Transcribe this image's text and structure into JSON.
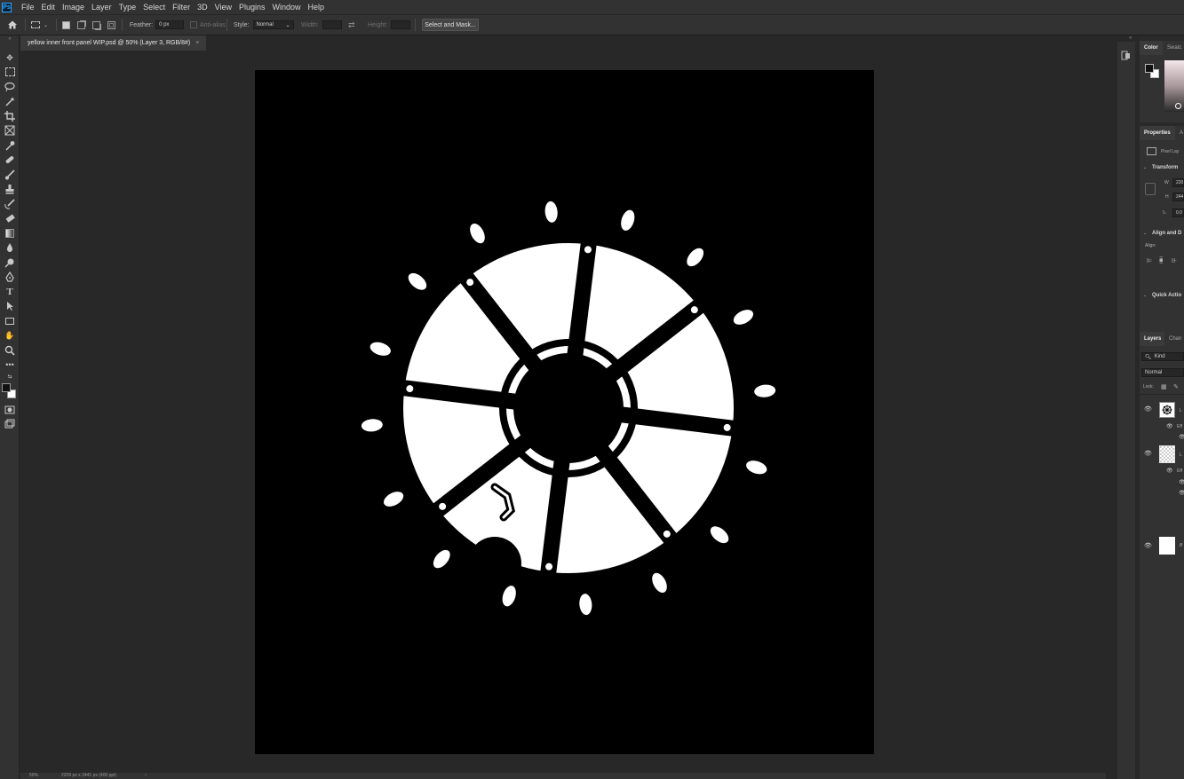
{
  "app": {
    "logo": "Ps"
  },
  "menu": [
    "File",
    "Edit",
    "Image",
    "Layer",
    "Type",
    "Select",
    "Filter",
    "3D",
    "View",
    "Plugins",
    "Window",
    "Help"
  ],
  "options": {
    "home_icon": "home-icon",
    "feather_label": "Feather:",
    "feather_value": "0 px",
    "antialias_label": "Anti-alias",
    "style_label": "Style:",
    "style_value": "Normal",
    "width_label": "Width:",
    "height_label": "Height:",
    "select_mask_label": "Select and Mask..."
  },
  "document": {
    "tab_title": "yellow inner front panel WIP.psd @ 50% (Layer 3, RGB/8#)",
    "close_glyph": "×"
  },
  "status": {
    "zoom": "50%",
    "dimensions": "2209 px x 2441 px (400 ppi)",
    "arrow": "›"
  },
  "color_panel": {
    "tabs": [
      "Color",
      "Swatc"
    ]
  },
  "properties": {
    "tabs": [
      "Properties",
      "A"
    ],
    "layer_kind": "Pixel Lay",
    "transform_label": "Transform",
    "w_label": "W",
    "w_value": "220",
    "h_label": "H",
    "h_value": "244",
    "angle_value": "0.0",
    "align_label": "Align and D",
    "align_sub": "Align:",
    "quick_actions_label": "Quick Actio"
  },
  "layers": {
    "tabs": [
      "Layers",
      "Chan"
    ],
    "search": "Kind",
    "blend_mode": "Normal",
    "lock_label": "Lock:",
    "items": [
      {
        "name": "L",
        "effects_label": "Eff"
      },
      {
        "name": "L",
        "effects_label": "Eff"
      },
      {
        "name": "B"
      }
    ]
  },
  "colors": {
    "canvas": "#000000",
    "artwork": "#ffffff",
    "ui_dark": "#282828",
    "ui_panel": "#323232"
  }
}
